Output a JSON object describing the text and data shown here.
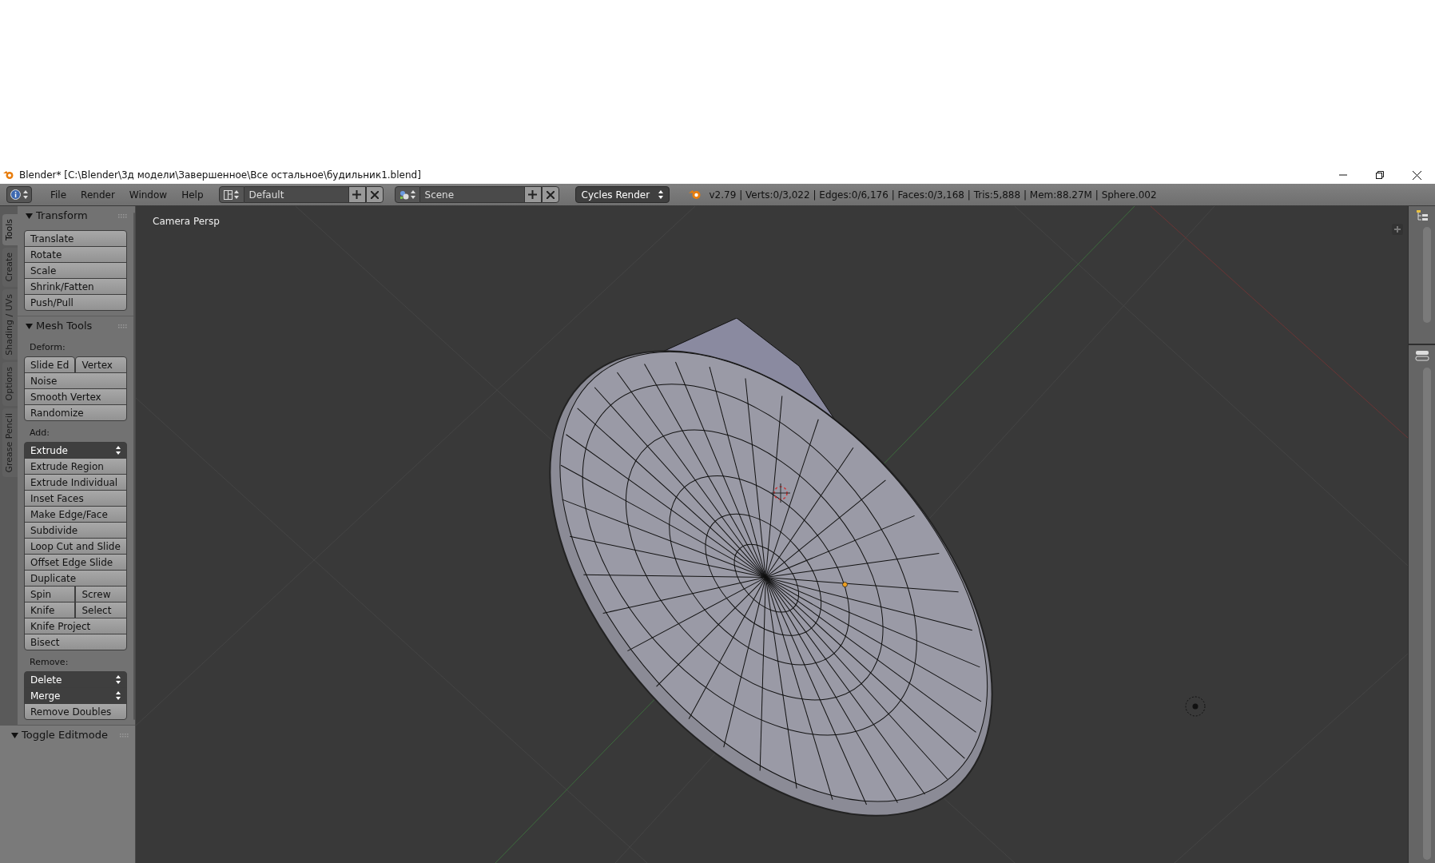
{
  "window": {
    "title": "Blender* [C:\\Blender\\3д модели\\Завершенное\\Все остальное\\будильник1.blend]"
  },
  "header": {
    "menus": [
      "File",
      "Render",
      "Window",
      "Help"
    ],
    "layout": "Default",
    "scene": "Scene",
    "engine": "Cycles Render",
    "stats": "v2.79 | Verts:0/3,022 | Edges:0/6,176 | Faces:0/3,168 | Tris:5,888 | Mem:88.27M | Sphere.002"
  },
  "tool_tabs": [
    {
      "label": "Tools",
      "selected": true
    },
    {
      "label": "Create",
      "selected": false
    },
    {
      "label": "Shading / UVs",
      "selected": false
    },
    {
      "label": "Options",
      "selected": false
    },
    {
      "label": "Grease Pencil",
      "selected": false
    }
  ],
  "panels": [
    {
      "title": "Transform",
      "expanded": true,
      "groups": [
        {
          "rows": [
            [
              {
                "label": "Translate",
                "kind": "button"
              }
            ],
            [
              {
                "label": "Rotate",
                "kind": "button"
              }
            ],
            [
              {
                "label": "Scale",
                "kind": "button"
              }
            ],
            [
              {
                "label": "Shrink/Fatten",
                "kind": "button"
              }
            ],
            [
              {
                "label": "Push/Pull",
                "kind": "button"
              }
            ]
          ]
        }
      ]
    },
    {
      "title": "Mesh Tools",
      "expanded": true,
      "groups": [
        {
          "label": "Deform:",
          "rows": [
            [
              {
                "label": "Slide Ed",
                "kind": "button"
              },
              {
                "label": "Vertex",
                "kind": "button"
              }
            ],
            [
              {
                "label": "Noise",
                "kind": "button"
              }
            ],
            [
              {
                "label": "Smooth Vertex",
                "kind": "button"
              }
            ],
            [
              {
                "label": "Randomize",
                "kind": "button"
              }
            ]
          ]
        },
        {
          "label": "Add:",
          "rows": [
            [
              {
                "label": "Extrude",
                "kind": "menu"
              }
            ],
            [
              {
                "label": "Extrude Region",
                "kind": "button"
              }
            ],
            [
              {
                "label": "Extrude Individual",
                "kind": "button"
              }
            ],
            [
              {
                "label": "Inset Faces",
                "kind": "button"
              }
            ],
            [
              {
                "label": "Make Edge/Face",
                "kind": "button"
              }
            ],
            [
              {
                "label": "Subdivide",
                "kind": "button"
              }
            ],
            [
              {
                "label": "Loop Cut and Slide",
                "kind": "button"
              }
            ],
            [
              {
                "label": "Offset Edge Slide",
                "kind": "button"
              }
            ],
            [
              {
                "label": "Duplicate",
                "kind": "button"
              }
            ],
            [
              {
                "label": "Spin",
                "kind": "button"
              },
              {
                "label": "Screw",
                "kind": "button"
              }
            ],
            [
              {
                "label": "Knife",
                "kind": "button"
              },
              {
                "label": "Select",
                "kind": "button"
              }
            ],
            [
              {
                "label": "Knife Project",
                "kind": "button"
              }
            ],
            [
              {
                "label": "Bisect",
                "kind": "button"
              }
            ]
          ]
        },
        {
          "label": "Remove:",
          "rows": [
            [
              {
                "label": "Delete",
                "kind": "menu"
              }
            ],
            [
              {
                "label": "Merge",
                "kind": "menu"
              }
            ],
            [
              {
                "label": "Remove Doubles",
                "kind": "button"
              }
            ]
          ]
        }
      ]
    }
  ],
  "operator_panel": {
    "title": "Toggle Editmode",
    "expanded": true
  },
  "viewport": {
    "label": "Camera Persp"
  }
}
